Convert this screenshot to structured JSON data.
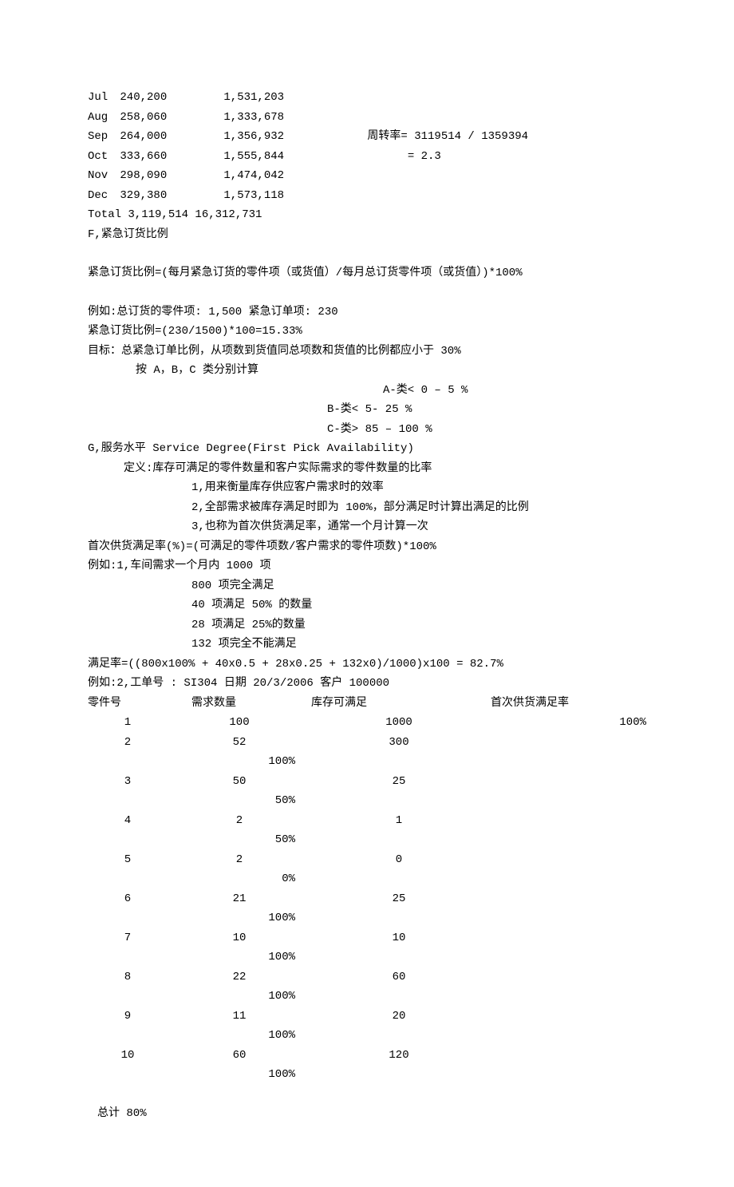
{
  "monthly": {
    "rows": [
      {
        "month": "Jul",
        "v1": "240,200",
        "v2": "1,531,203",
        "note": ""
      },
      {
        "month": "Aug",
        "v1": "258,060",
        "v2": "1,333,678",
        "note": ""
      },
      {
        "month": "Sep",
        "v1": "264,000",
        "v2": "1,356,932",
        "note": "周转率= 3119514 / 1359394"
      },
      {
        "month": "Oct",
        "v1": "333,660",
        "v2": "1,555,844",
        "note": "      = 2.3"
      },
      {
        "month": "Nov",
        "v1": "298,090",
        "v2": "1,474,042",
        "note": ""
      },
      {
        "month": "Dec",
        "v1": "329,380",
        "v2": "1,573,118",
        "note": ""
      }
    ],
    "total": "Total 3,119,514 16,312,731"
  },
  "sectionF": {
    "title": "F,紧急订货比例",
    "formula": "紧急订货比例=(每月紧急订货的零件项（或货值）/每月总订货零件项（或货值）)*100%",
    "example1": "例如:总订货的零件项: 1,500 紧急订单项: 230",
    "example2": "紧急订货比例=(230/1500)*100=15.33%",
    "target": "目标：总紧急订单比例，从项数到货值同总项数和货值的比例都应小于 30%",
    "byClass": "按 A，B，C 类分别计算",
    "classA": "A-类< 0  – 5 %",
    "classB": "B-类< 5- 25 %",
    "classC": "C-类> 85  – 100 %"
  },
  "sectionG": {
    "title": "G,服务水平 Service Degree(First Pick Availability)",
    "def": "定义:库存可满足的零件数量和客户实际需求的零件数量的比率",
    "p1": "1,用来衡量库存供应客户需求时的效率",
    "p2": "2,全部需求被库存满足时即为 100%，部分满足时计算出满足的比例",
    "p3": "3,也称为首次供货满足率，通常一个月计算一次",
    "formula": "首次供货满足率(%)=(可满足的零件项数/客户需求的零件项数)*100%",
    "ex1": {
      "head": "例如:1,车间需求一个月内 1000 项",
      "l1": "800 项完全满足",
      "l2": "40 项满足 50% 的数量",
      "l3": "28 项满足 25%的数量",
      "l4": "132 项完全不能满足",
      "calc": "满足率=((800x100% + 40x0.5 + 28x0.25 + 132x0)/1000)x100 = 82.7%"
    },
    "ex2": {
      "head": "例如:2,工单号 : SI304 日期 20/3/2006 客户 100000",
      "th": {
        "part": "零件号",
        "demand": "需求数量",
        "stock": "库存可满足",
        "rate": "首次供货满足率"
      },
      "rows": [
        {
          "part": "1",
          "demand": "100",
          "stock": "1000",
          "rate": "100%"
        },
        {
          "part": "2",
          "demand": "52",
          "stock": "300",
          "rate": "100%"
        },
        {
          "part": "3",
          "demand": "50",
          "stock": "25",
          "rate": "50%"
        },
        {
          "part": "4",
          "demand": "2",
          "stock": "1",
          "rate": "50%"
        },
        {
          "part": "5",
          "demand": "2",
          "stock": "0",
          "rate": "0%"
        },
        {
          "part": "6",
          "demand": "21",
          "stock": "25",
          "rate": "100%"
        },
        {
          "part": "7",
          "demand": "10",
          "stock": "10",
          "rate": "100%"
        },
        {
          "part": "8",
          "demand": "22",
          "stock": "60",
          "rate": "100%"
        },
        {
          "part": "9",
          "demand": "11",
          "stock": "20",
          "rate": "100%"
        },
        {
          "part": "10",
          "demand": "60",
          "stock": "120",
          "rate": "100%"
        }
      ],
      "total": "总计 80%"
    }
  }
}
